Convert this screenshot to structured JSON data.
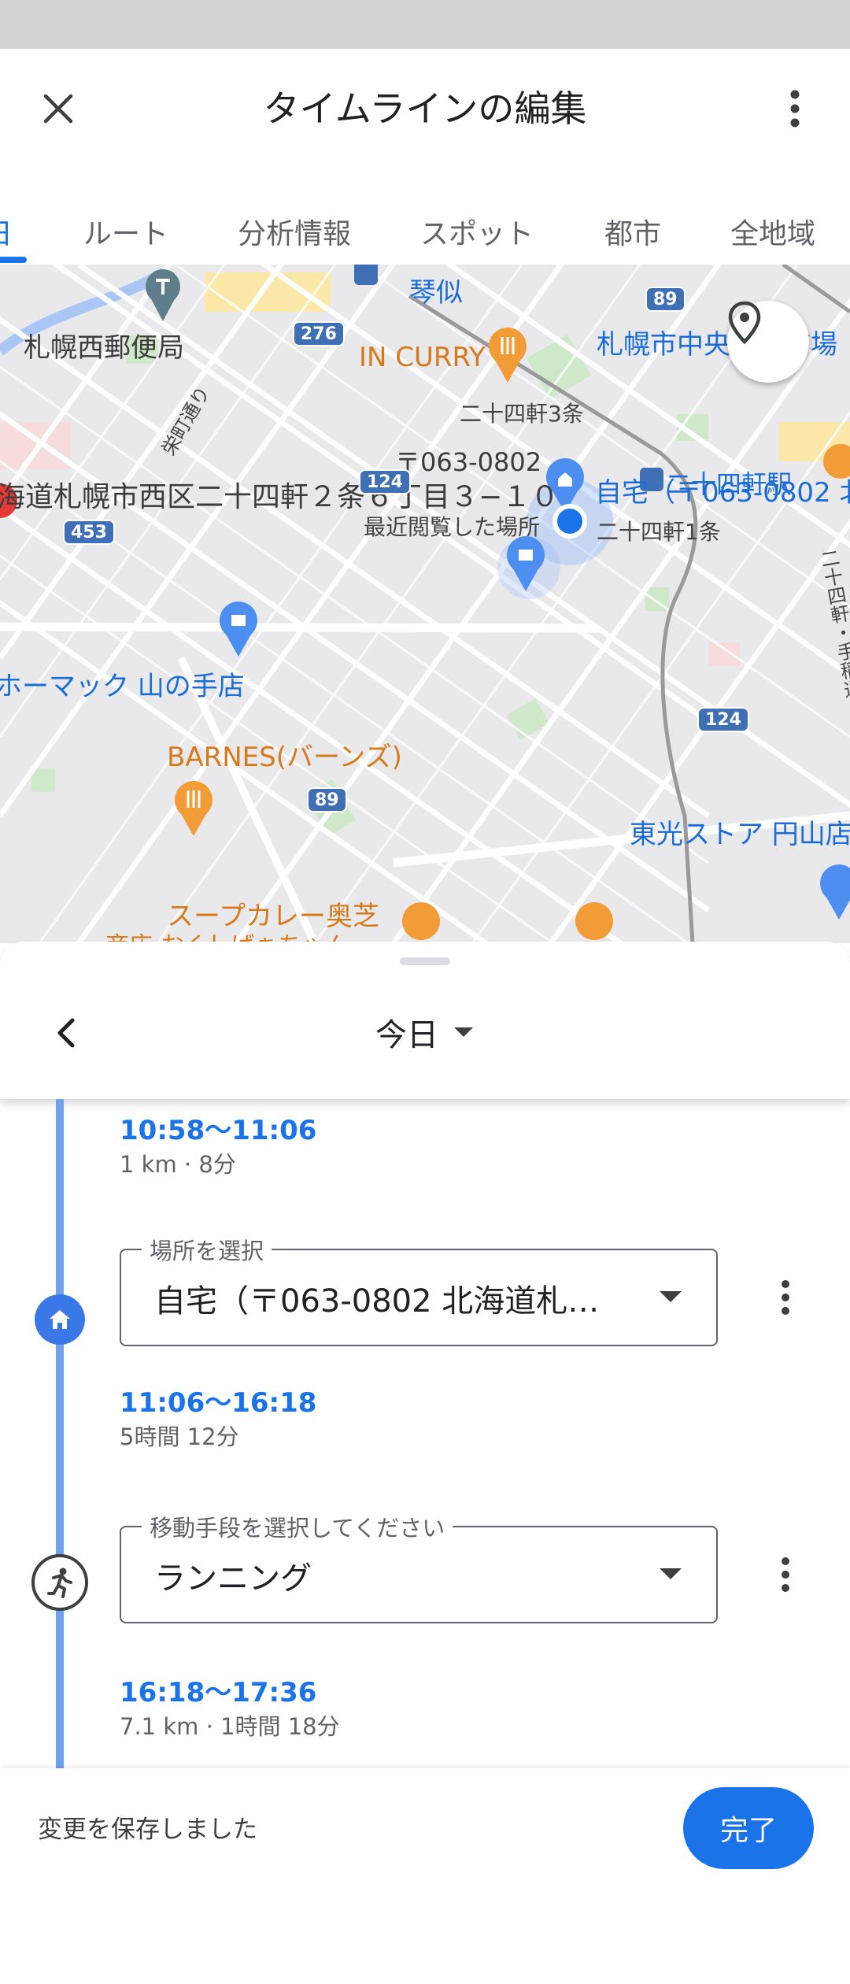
{
  "header": {
    "title": "タイムラインの編集"
  },
  "tabs": [
    {
      "label": "日"
    },
    {
      "label": "ルート"
    },
    {
      "label": "分析情報"
    },
    {
      "label": "スポット"
    },
    {
      "label": "都市"
    },
    {
      "label": "全地域"
    }
  ],
  "map": {
    "labels": {
      "post_office": "札幌西郵便局",
      "kotoni": "琴似",
      "central_market": "札幌市中央卸売市場",
      "in_curry": "IN CURRY",
      "jo3": "二十四軒3条",
      "postal_code": "〒063-0802",
      "address": "海道札幌市西区二十四軒２条６丁目３−１０",
      "home": "自宅（〒063-0802 北",
      "station": "二十四軒駅",
      "recent": "最近閲覧した場所",
      "jo1": "二十四軒1条",
      "homac": "ホーマック 山の手店",
      "barnes": "BARNES(バーンズ)",
      "soup_curry": "スープカレー奥芝",
      "soup_curry_2": "商店 おくしばぁちゃん",
      "tokou": "東光ストア 円山店",
      "eiko_dori": "栄町通り",
      "teine_dori": "二十四軒・手稲通",
      "road_276": "276",
      "road_89a": "89",
      "road_89b": "89",
      "road_124a": "124",
      "road_124b": "124",
      "road_453": "453"
    }
  },
  "sheet": {
    "date_label": "今日"
  },
  "timeline": {
    "segment1": {
      "time": "10:58〜11:06",
      "detail": "1 km · 8分"
    },
    "place": {
      "legend": "場所を選択",
      "value": "自宅（〒063-0802 北海道札…"
    },
    "segment2": {
      "time": "11:06〜16:18",
      "detail": "5時間 12分"
    },
    "transport": {
      "legend": "移動手段を選択してください",
      "value": "ランニング"
    },
    "segment3": {
      "time": "16:18〜17:36",
      "detail": "7.1 km · 1時間 18分"
    }
  },
  "footer": {
    "status": "変更を保存しました",
    "done_label": "完了"
  },
  "colors": {
    "accent": "#1a73e8",
    "timeline_line": "#6ea1f0"
  }
}
